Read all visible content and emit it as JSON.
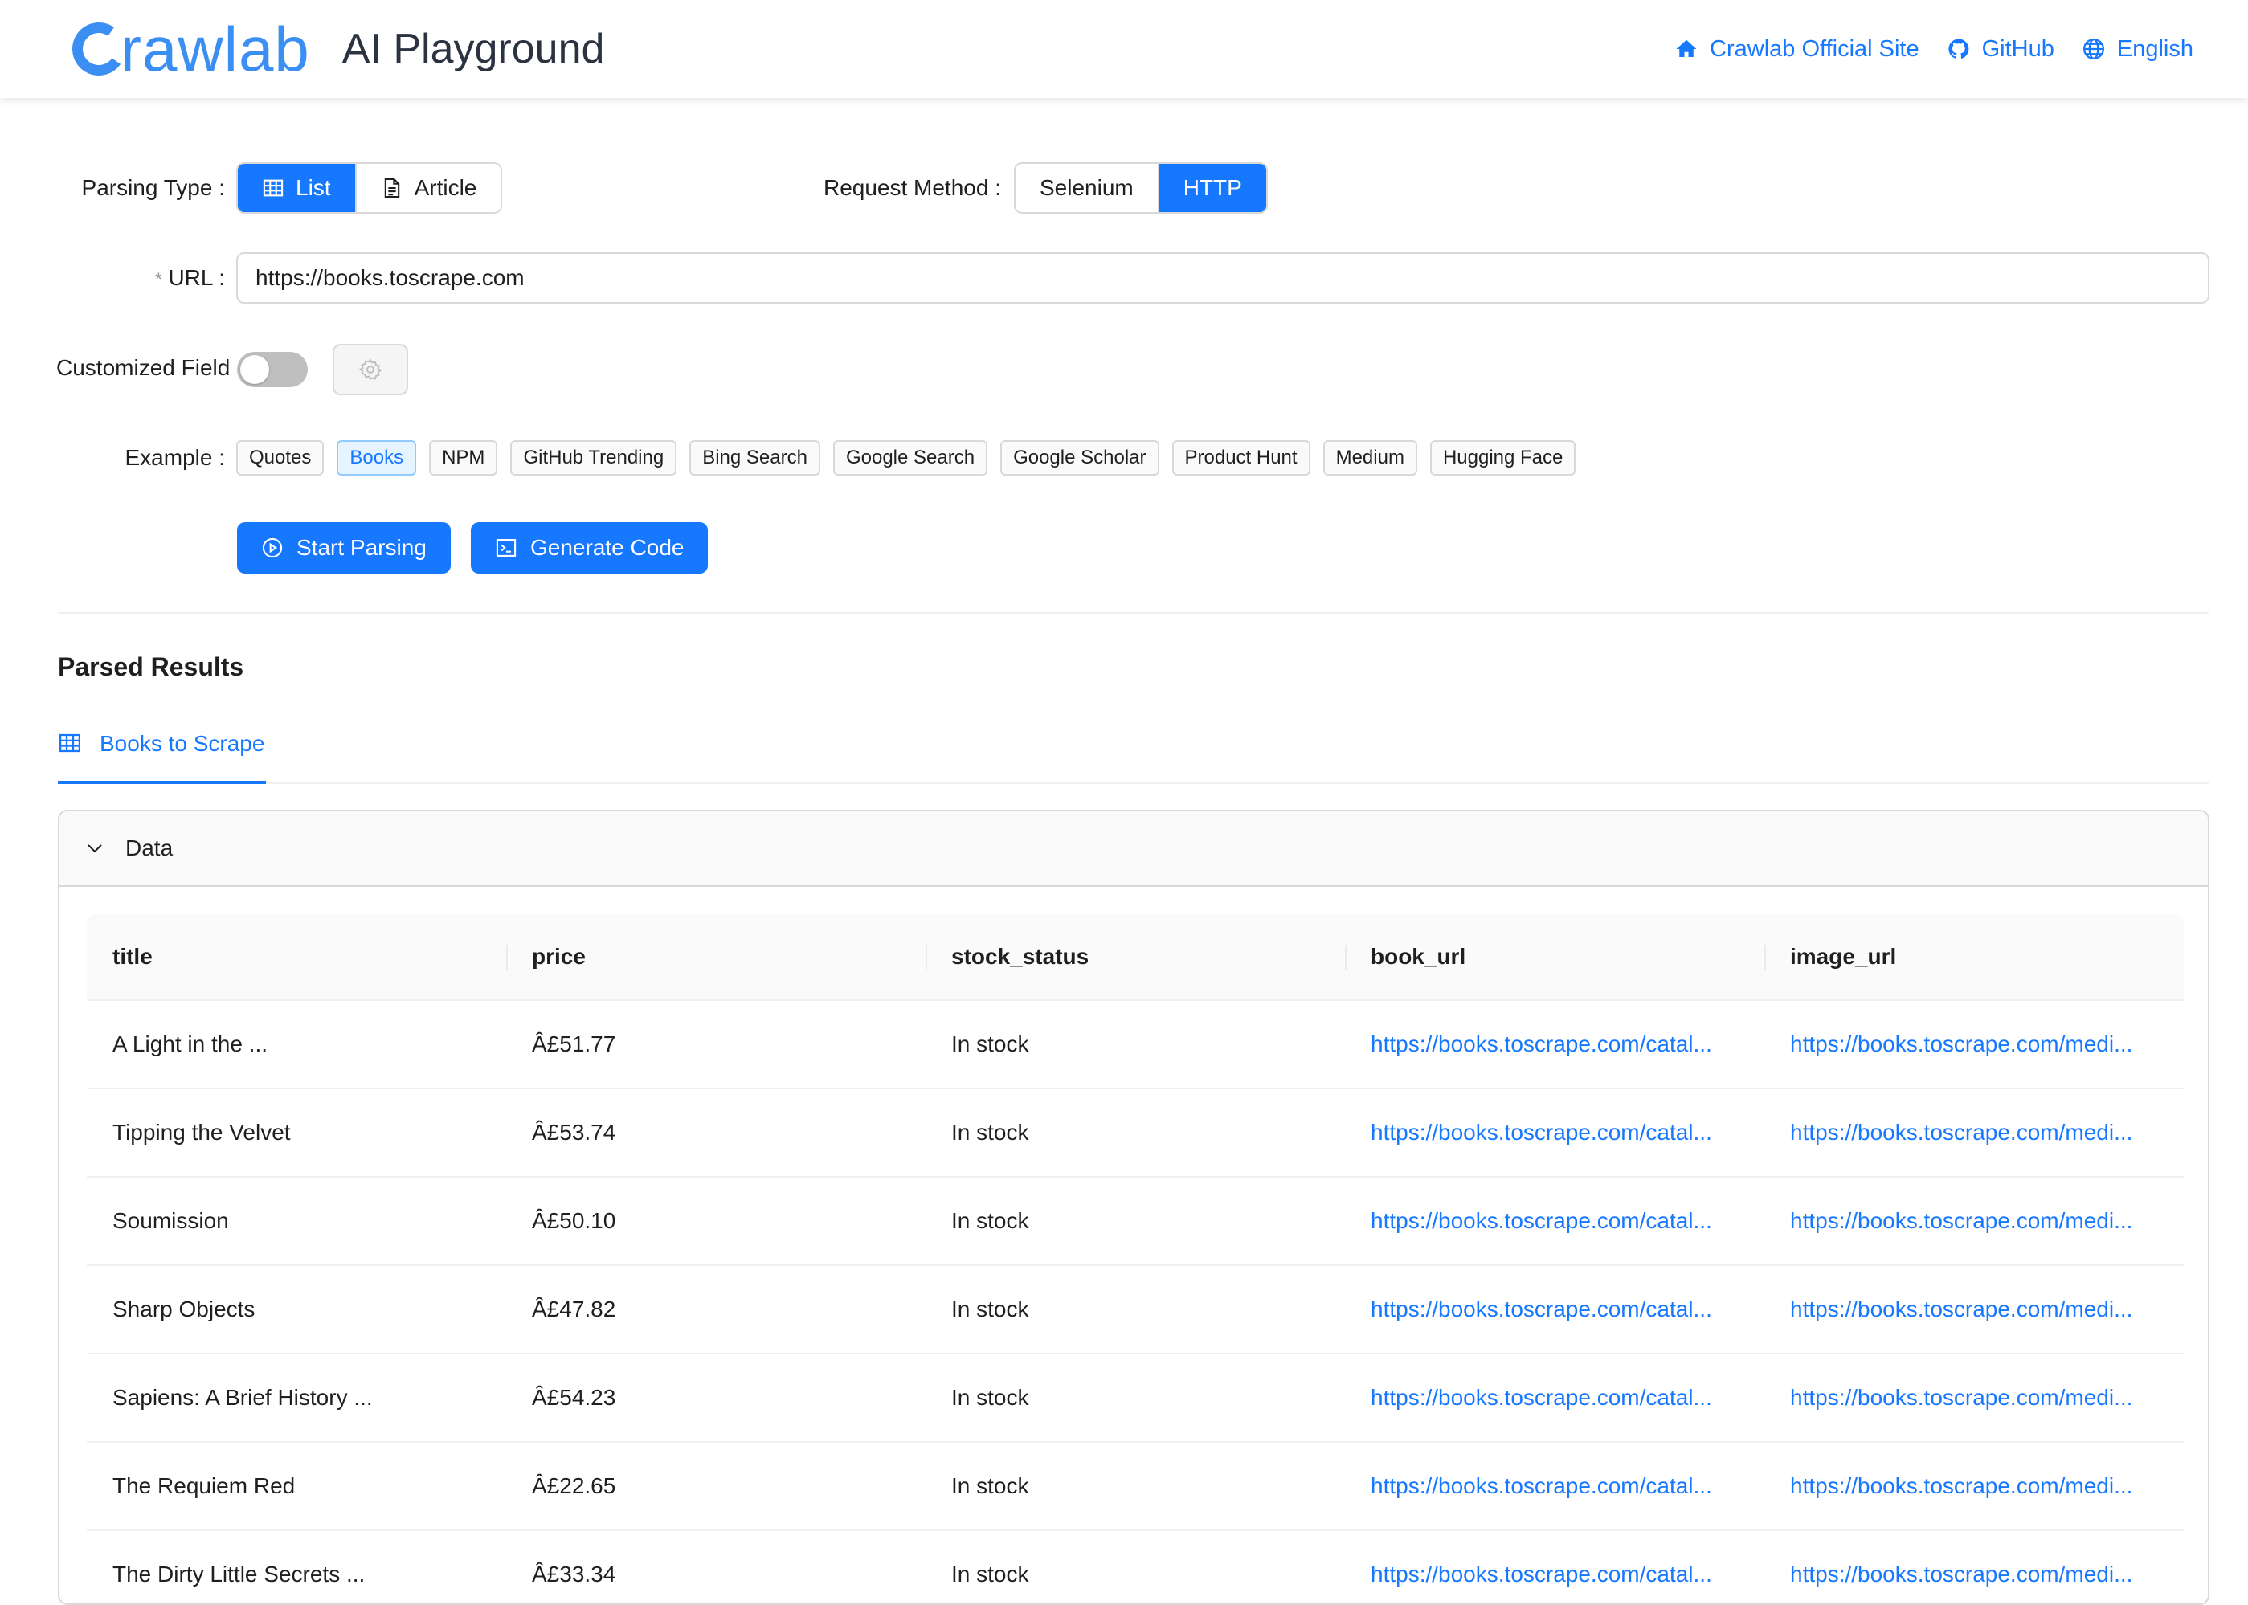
{
  "header": {
    "logo_text": "rawlab",
    "app_title": "AI Playground",
    "links": [
      {
        "label": "Crawlab Official Site",
        "icon": "home-icon"
      },
      {
        "label": "GitHub",
        "icon": "github-icon"
      },
      {
        "label": "English",
        "icon": "globe-icon"
      }
    ]
  },
  "form": {
    "parsing_type": {
      "label": "Parsing Type",
      "options": [
        {
          "label": "List",
          "icon": "table-icon",
          "active": true
        },
        {
          "label": "Article",
          "icon": "document-icon",
          "active": false
        }
      ]
    },
    "request_method": {
      "label": "Request Method",
      "options": [
        {
          "label": "Selenium",
          "active": false
        },
        {
          "label": "HTTP",
          "active": true
        }
      ]
    },
    "url": {
      "label": "URL",
      "required_mark": "*",
      "value": "https://books.toscrape.com"
    },
    "customized_field": {
      "label": "Customized Field",
      "enabled": false,
      "settings_icon": "gear-icon"
    },
    "example": {
      "label": "Example",
      "tags": [
        "Quotes",
        "Books",
        "NPM",
        "GitHub Trending",
        "Bing Search",
        "Google Search",
        "Google Scholar",
        "Product Hunt",
        "Medium",
        "Hugging Face"
      ],
      "active": "Books"
    },
    "actions": {
      "start_parsing": "Start Parsing",
      "generate_code": "Generate Code"
    }
  },
  "results": {
    "title": "Parsed Results",
    "tab": "Books to Scrape",
    "collapse_title": "Data",
    "columns": [
      "title",
      "price",
      "stock_status",
      "book_url",
      "image_url"
    ],
    "rows": [
      [
        "A Light in the ...",
        "Â£51.77",
        "In stock",
        "https://books.toscrape.com/catal...",
        "https://books.toscrape.com/medi..."
      ],
      [
        "Tipping the Velvet",
        "Â£53.74",
        "In stock",
        "https://books.toscrape.com/catal...",
        "https://books.toscrape.com/medi..."
      ],
      [
        "Soumission",
        "Â£50.10",
        "In stock",
        "https://books.toscrape.com/catal...",
        "https://books.toscrape.com/medi..."
      ],
      [
        "Sharp Objects",
        "Â£47.82",
        "In stock",
        "https://books.toscrape.com/catal...",
        "https://books.toscrape.com/medi..."
      ],
      [
        "Sapiens: A Brief History ...",
        "Â£54.23",
        "In stock",
        "https://books.toscrape.com/catal...",
        "https://books.toscrape.com/medi..."
      ],
      [
        "The Requiem Red",
        "Â£22.65",
        "In stock",
        "https://books.toscrape.com/catal...",
        "https://books.toscrape.com/medi..."
      ],
      [
        "The Dirty Little Secrets ...",
        "Â£33.34",
        "In stock",
        "https://books.toscrape.com/catal...",
        "https://books.toscrape.com/medi..."
      ]
    ]
  },
  "colors": {
    "primary": "#1677ff",
    "logo": "#3b8ff3"
  }
}
